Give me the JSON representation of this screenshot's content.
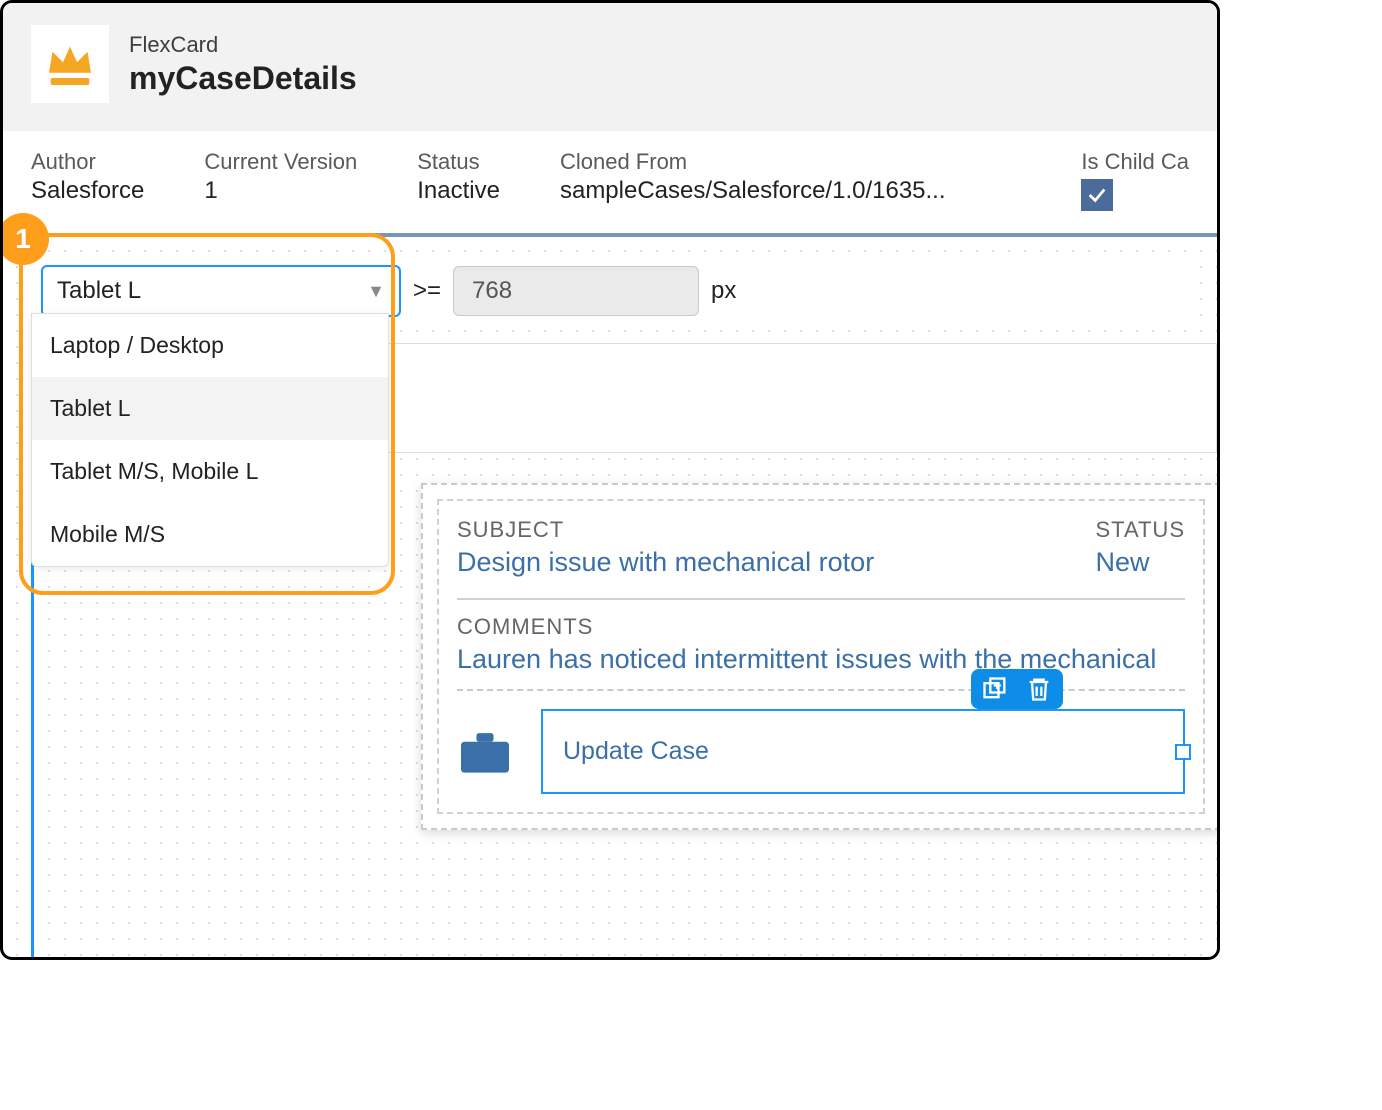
{
  "header": {
    "type_label": "FlexCard",
    "title": "myCaseDetails"
  },
  "meta": {
    "author_label": "Author",
    "author_value": "Salesforce",
    "version_label": "Current Version",
    "version_value": "1",
    "status_label": "Status",
    "status_value": "Inactive",
    "cloned_label": "Cloned From",
    "cloned_value": "sampleCases/Salesforce/1.0/1635...",
    "child_label": "Is Child Ca",
    "child_checked": true
  },
  "viewport": {
    "selected": "Tablet L",
    "operator": ">=",
    "pixels": "768",
    "unit": "px",
    "options": [
      "Laptop / Desktop",
      "Tablet L",
      "Tablet M/S, Mobile L",
      "Mobile M/S"
    ]
  },
  "callout": {
    "number": "1"
  },
  "card": {
    "subject_label": "SUBJECT",
    "subject_value": "Design issue with mechanical rotor",
    "status_label": "STATUS",
    "status_value": "New",
    "comments_label": "COMMENTS",
    "comments_value": "Lauren has noticed intermittent issues with the mechanical",
    "action_label": "Update Case"
  }
}
